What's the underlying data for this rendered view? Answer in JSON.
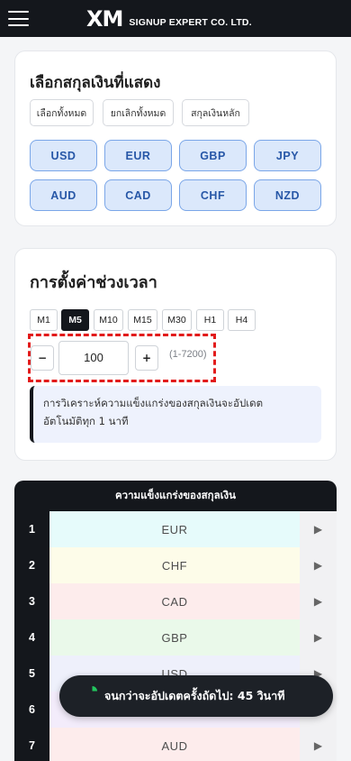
{
  "header": {
    "brand": "XM",
    "brand_sub": "SIGNUP EXPERT CO. LTD."
  },
  "currency_card": {
    "title": "เลือกสกุลเงินที่แสดง",
    "select_all": "เลือกทั้งหมด",
    "deselect_all": "ยกเลิกทั้งหมด",
    "major": "สกุลเงินหลัก",
    "currencies": [
      "USD",
      "EUR",
      "GBP",
      "JPY",
      "AUD",
      "CAD",
      "CHF",
      "NZD"
    ]
  },
  "time_card": {
    "title": "การตั้งค่าช่วงเวลา",
    "timeframes": [
      "M1",
      "M5",
      "M10",
      "M15",
      "M30",
      "H1",
      "H4"
    ],
    "active_timeframe": "M5",
    "minus": "−",
    "plus": "+",
    "value": "100",
    "range": "(1-7200)",
    "info_line1": "การวิเคราะห์ความแข็งแกร่งของสกุลเงินจะอัปเดต",
    "info_line2": "อัตโนมัติทุก 1 นาที"
  },
  "strength_table": {
    "title": "ความแข็งแกร่งของสกุลเงิน",
    "rows": [
      {
        "rank": "1",
        "currency": "EUR",
        "bg": "#e6fbfb"
      },
      {
        "rank": "2",
        "currency": "CHF",
        "bg": "#fdfce9"
      },
      {
        "rank": "3",
        "currency": "CAD",
        "bg": "#fdecec"
      },
      {
        "rank": "4",
        "currency": "GBP",
        "bg": "#eaf9ea"
      },
      {
        "rank": "5",
        "currency": "USD",
        "bg": "#eef0fb"
      },
      {
        "rank": "6",
        "currency": "",
        "bg": "#f3ecfb"
      },
      {
        "rank": "7",
        "currency": "AUD",
        "bg": "#fdecec"
      }
    ],
    "arrow": "▶"
  },
  "toast": {
    "text": "จนกว่าจะอัปเดตครั้งถัดไป: 45 วินาที",
    "accent": "#22c55e"
  }
}
